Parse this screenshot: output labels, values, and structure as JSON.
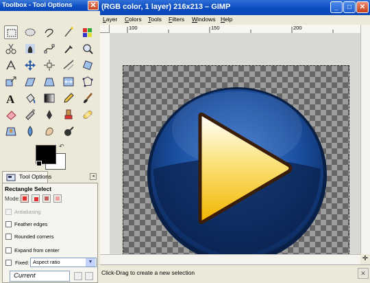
{
  "toolbox": {
    "title": "Toolbox - Tool Options",
    "close": "✕",
    "tools": [
      "rect-select",
      "ellipse-select",
      "free-select",
      "fuzzy-select",
      "select-by-color",
      "scissors",
      "foreground-select",
      "paths",
      "color-picker",
      "zoom",
      "measure",
      "move",
      "align",
      "crop",
      "rotate",
      "scale",
      "shear",
      "perspective",
      "flip",
      "cage",
      "text",
      "bucket-fill",
      "blend",
      "pencil",
      "paintbrush",
      "eraser",
      "airbrush",
      "ink",
      "clone",
      "heal",
      "perspective-clone",
      "blur",
      "smudge",
      "dodge-burn"
    ],
    "colors": {
      "foreground": "#000000",
      "background": "#ffffff"
    },
    "swap_glyph": "↶",
    "tab_label": "Tool Options",
    "tab_menu": "◂",
    "options": {
      "title": "Rectangle Select",
      "mode_label": "Mode:",
      "antialiasing": "Antialiasing",
      "feather_edges": "Feather edges",
      "rounded_corners": "Rounded corners",
      "expand_from_center": "Expand from center",
      "fixed_label": "Fixed:",
      "fixed_value": "Aspect ratio",
      "current": "Current"
    }
  },
  "image_window": {
    "title": "(RGB color, 1 layer) 216x213 – GIMP",
    "minimize": "_",
    "maximize": "□",
    "close": "✕",
    "menu": [
      {
        "label": "Layer",
        "u": "L",
        "rest": "ayer"
      },
      {
        "label": "Colors",
        "u": "C",
        "rest": "olors"
      },
      {
        "label": "Tools",
        "u": "T",
        "rest": "ools"
      },
      {
        "label": "Filters",
        "u": "F",
        "rest": "ilters"
      },
      {
        "label": "Windows",
        "u": "W",
        "rest": "indows"
      },
      {
        "label": "Help",
        "u": "H",
        "rest": "elp"
      }
    ],
    "ruler_ticks": [
      "100",
      "150",
      "200"
    ],
    "status": "Click-Drag to create a new selection",
    "nav_glyph": "✛",
    "cancel_glyph": "✕"
  },
  "colors": {
    "titlebar": "#0a47b8",
    "chrome": "#ece9d8",
    "orb_dark": "#0c2a5e",
    "orb_mid": "#1b4fa0",
    "play_yellow": "#f7c300",
    "play_border": "#3a1d08"
  }
}
